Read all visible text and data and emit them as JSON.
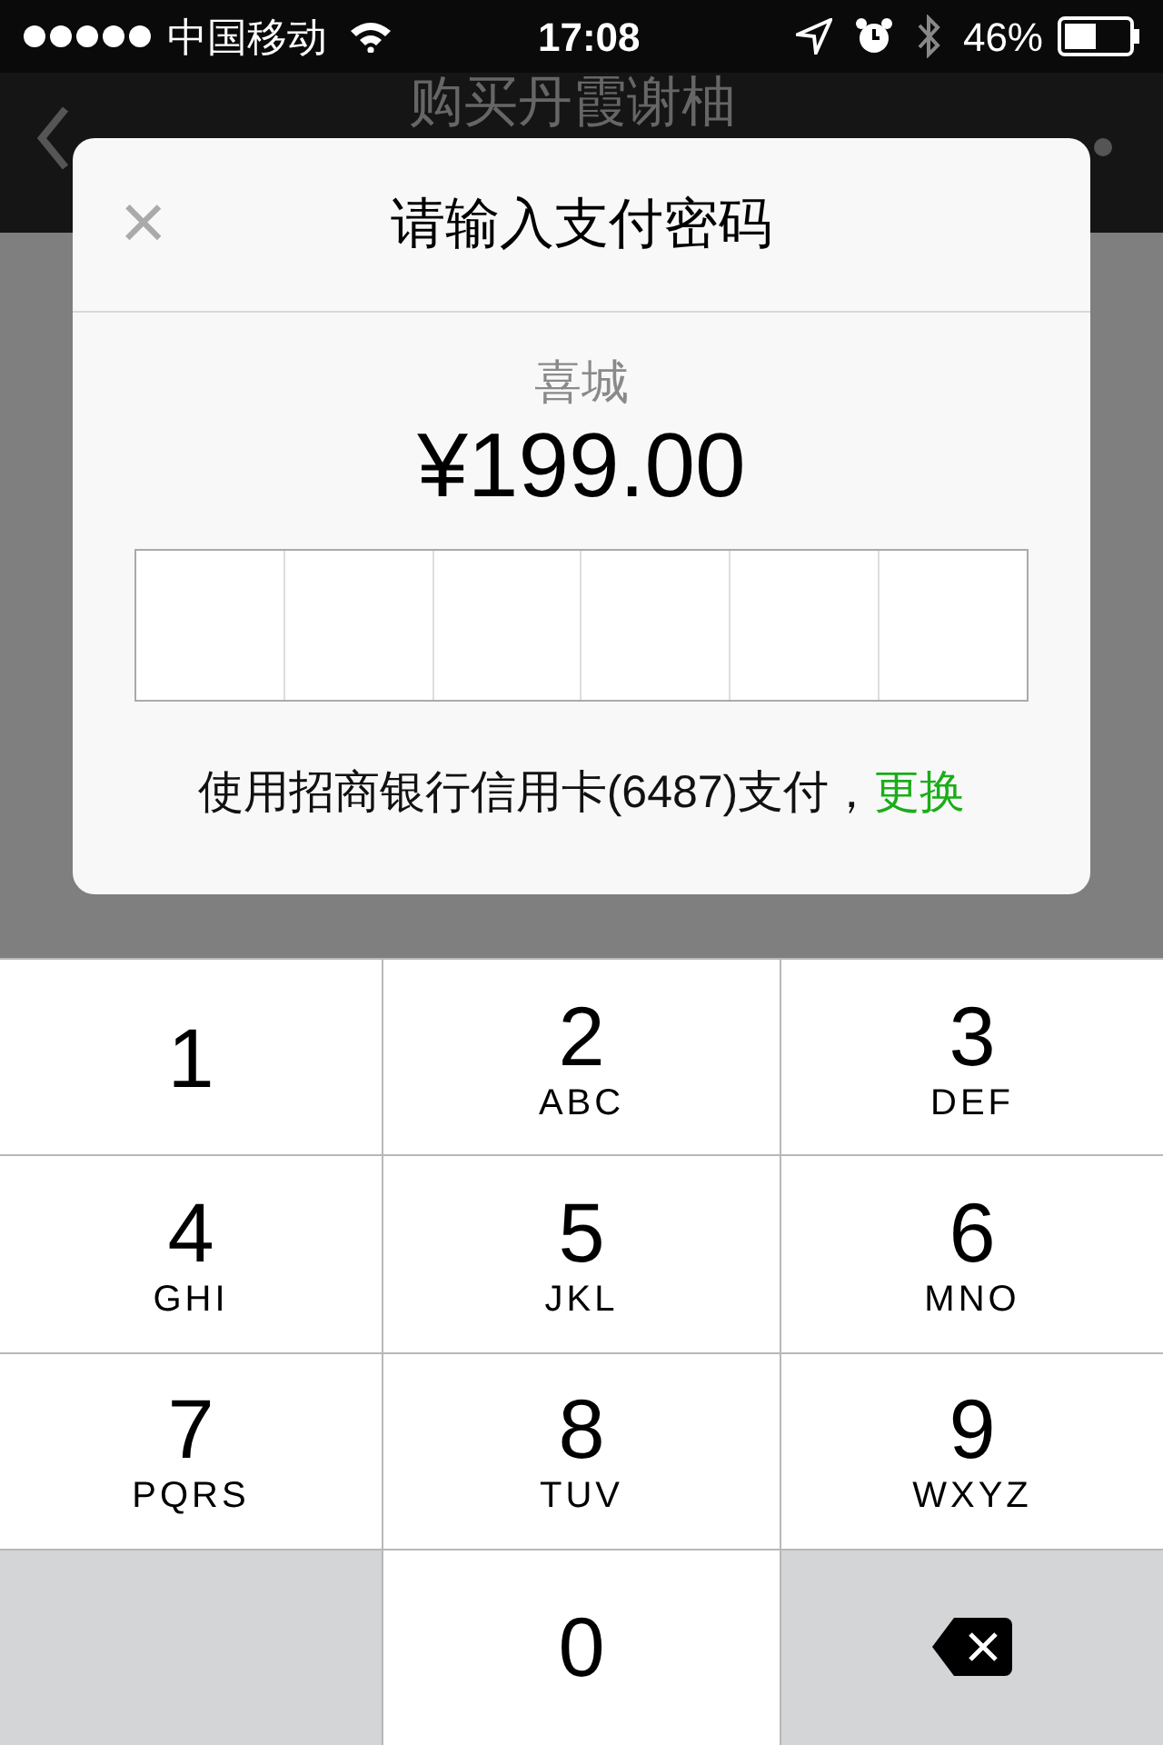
{
  "status_bar": {
    "carrier": "中国移动",
    "time": "17:08",
    "battery": "46%"
  },
  "nav_bar": {
    "title": "购买丹霞谢柚"
  },
  "dialog": {
    "close": "×",
    "title": "请输入支付密码",
    "merchant": "喜城",
    "amount": "¥199.00",
    "payment_method": "使用招商银行信用卡(6487)支付，",
    "change_link": "更换"
  },
  "keypad": [
    {
      "kind": "digit",
      "digit": "1"
    },
    {
      "kind": "digit",
      "digit": "2",
      "letters": "ABC"
    },
    {
      "kind": "digit",
      "digit": "3",
      "letters": "DEF"
    },
    {
      "kind": "digit",
      "digit": "4",
      "letters": "GHI"
    },
    {
      "kind": "digit",
      "digit": "5",
      "letters": "JKL"
    },
    {
      "kind": "digit",
      "digit": "6",
      "letters": "MNO"
    },
    {
      "kind": "digit",
      "digit": "7",
      "letters": "PQRS"
    },
    {
      "kind": "digit",
      "digit": "8",
      "letters": "TUV"
    },
    {
      "kind": "digit",
      "digit": "9",
      "letters": "WXYZ"
    },
    {
      "kind": "blank"
    },
    {
      "kind": "digit",
      "digit": "0"
    },
    {
      "kind": "delete"
    }
  ]
}
